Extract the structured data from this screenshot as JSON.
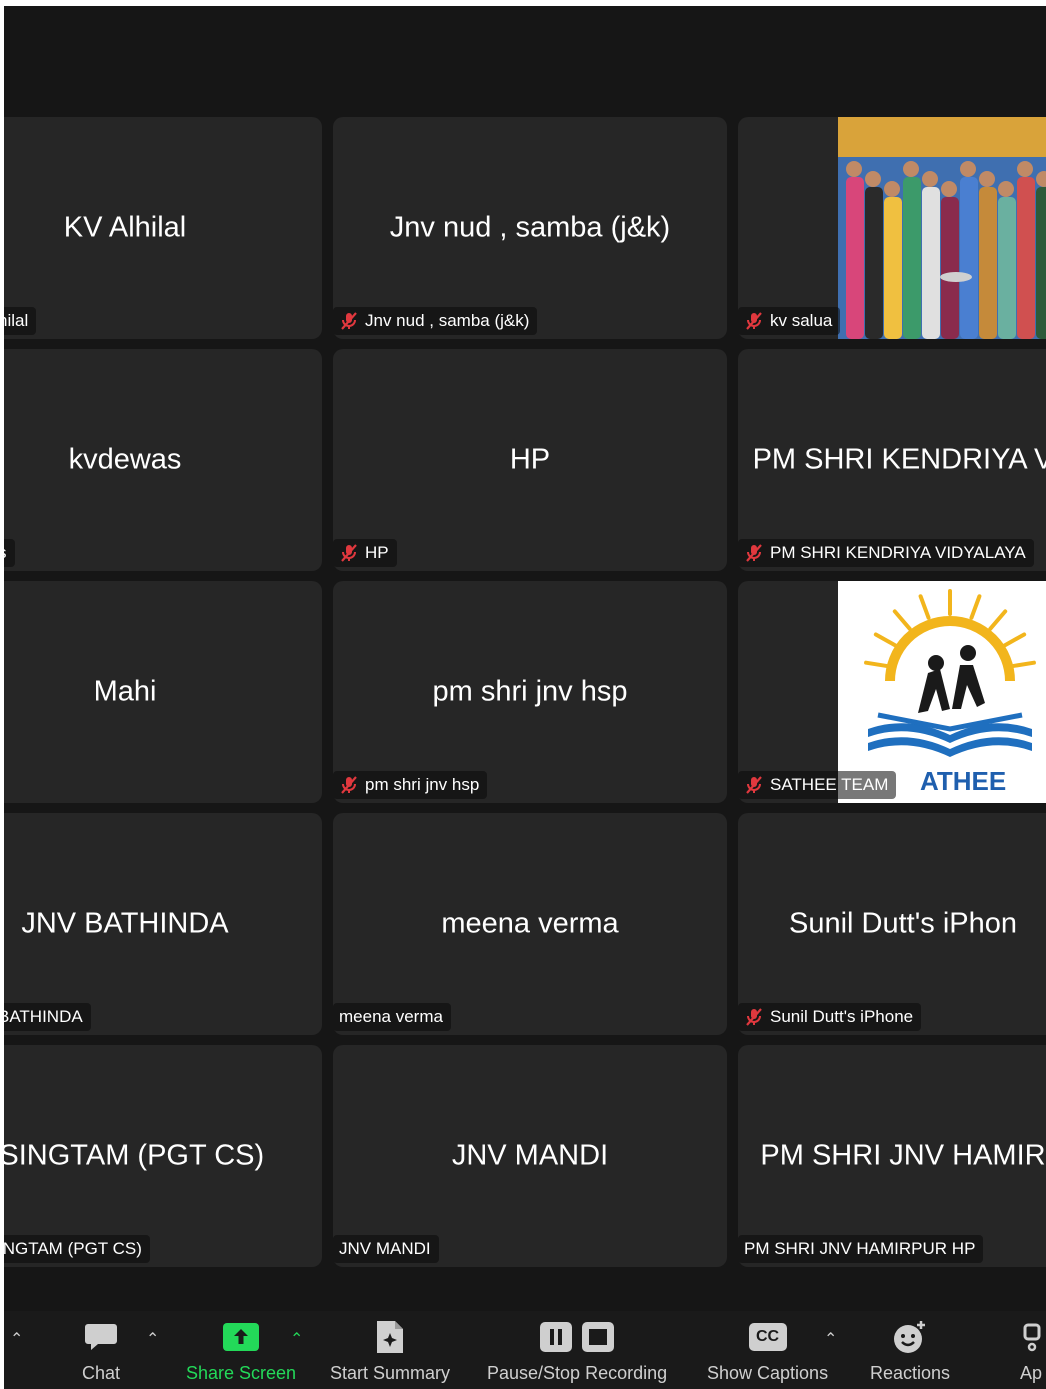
{
  "tiles": [
    {
      "big": "KV Alhilal",
      "tag": "hilal",
      "muted": false
    },
    {
      "big": "Jnv nud , samba (j&k)",
      "tag": "Jnv nud , samba (j&k)",
      "muted": true
    },
    {
      "big": "",
      "tag": "kv salua",
      "muted": true,
      "video": "group-photo"
    },
    {
      "big": "kvdewas",
      "tag": "s",
      "muted": false
    },
    {
      "big": "HP",
      "tag": "HP",
      "muted": true
    },
    {
      "big": "PM SHRI KENDRIYA V",
      "tag": "PM SHRI KENDRIYA VIDYALAYA",
      "muted": true
    },
    {
      "big": "Mahi",
      "tag": "",
      "muted": false
    },
    {
      "big": "pm shri jnv hsp",
      "tag": "pm shri jnv hsp",
      "muted": true
    },
    {
      "big": "",
      "tag": "SATHEE TEAM",
      "muted": true,
      "video": "sathee-logo"
    },
    {
      "big": "JNV BATHINDA",
      "tag": "BATHINDA",
      "muted": false
    },
    {
      "big": "meena verma",
      "tag": "meena verma",
      "muted": false
    },
    {
      "big": "Sunil Dutt's iPhon",
      "tag": "Sunil Dutt's iPhone",
      "muted": true
    },
    {
      "big": "' SINGTAM (PGT CS)",
      "tag": "INGTAM (PGT CS)",
      "muted": false
    },
    {
      "big": "JNV MANDI",
      "tag": "JNV MANDI",
      "muted": false
    },
    {
      "big": "PM SHRI JNV HAMIR",
      "tag": "PM SHRI JNV HAMIRPUR HP",
      "muted": false
    }
  ],
  "sathee_logo_text": "ATHEE",
  "toolbar": {
    "chat": "Chat",
    "share_screen": "Share Screen",
    "start_summary": "Start Summary",
    "pause_stop_recording": "Pause/Stop Recording",
    "show_captions": "Show Captions",
    "reactions": "Reactions",
    "apps": "Ap",
    "cc_glyph": "CC"
  },
  "colors": {
    "background": "#161616",
    "tile": "#262626",
    "mute_red": "#e0383e",
    "share_green": "#23d959"
  }
}
